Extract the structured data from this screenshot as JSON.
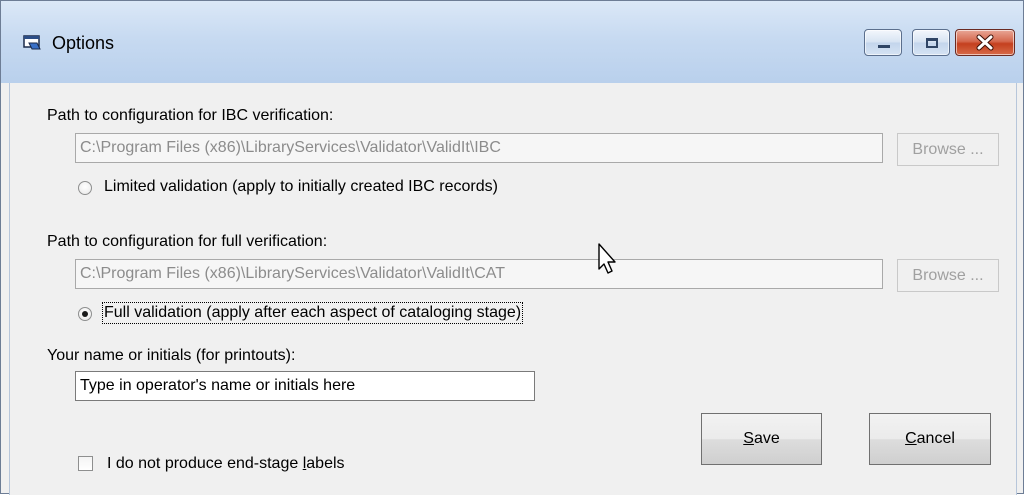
{
  "window": {
    "title": "Options",
    "icon": "window-app-icon",
    "controls": [
      "minimize-icon",
      "maximize-icon",
      "close-icon"
    ]
  },
  "ibc": {
    "label": "Path to configuration for IBC verification:",
    "path": "C:\\Program Files (x86)\\LibraryServices\\Validator\\ValidIt\\IBC",
    "browse_label": "Browse ...",
    "radio_label": "Limited validation (apply to initially created IBC records)",
    "radio_checked": false
  },
  "full": {
    "label": "Path to configuration for full verification:",
    "path": "C:\\Program Files (x86)\\LibraryServices\\Validator\\ValidIt\\CAT",
    "browse_label": "Browse ...",
    "radio_label": "Full validation (apply after each aspect of cataloging stage)",
    "radio_checked": true
  },
  "operator": {
    "label": "Your name or initials (for printouts):",
    "value": "Type in operator's name or initials here"
  },
  "labels_checkbox": {
    "label_before": "I do not produce end-stage ",
    "label_accel": "l",
    "label_after": "abels",
    "checked": false
  },
  "actions": {
    "save_accel": "S",
    "save_rest": "ave",
    "cancel_accel": "C",
    "cancel_rest": "ancel"
  },
  "colors": {
    "title_bar": "#c7daf1",
    "close_button": "#c4401f",
    "dialog_bg": "#f0f0f0"
  }
}
